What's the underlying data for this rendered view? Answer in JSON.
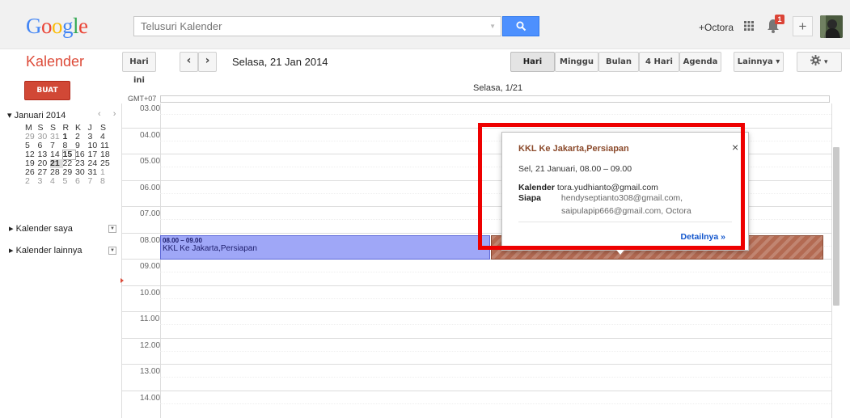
{
  "header": {
    "logo_letters": [
      "G",
      "o",
      "o",
      "g",
      "l",
      "e"
    ],
    "logo_colors": [
      "#4285f4",
      "#ea4335",
      "#fbbc05",
      "#4285f4",
      "#34a853",
      "#ea4335"
    ],
    "search_placeholder": "Telusuri Kalender",
    "user_name": "+Octora",
    "notification_count": "1",
    "share_label": "+"
  },
  "toolbar": {
    "app_title": "Kalender",
    "today_label": "Hari ini",
    "prev_label": "‹",
    "next_label": "›",
    "date_range": "Selasa, 21 Jan 2014",
    "views": {
      "day": "Hari",
      "week": "Minggu",
      "month": "Bulan",
      "four_days": "4 Hari",
      "agenda": "Agenda",
      "more": "Lainnya ▾"
    },
    "active_view": "Hari",
    "settings_caret": "▾"
  },
  "sidebar": {
    "create_label": "BUAT",
    "mini_calendar": {
      "month_label": "▾ Januari 2014",
      "nav": "‹ ›",
      "weekday_headers": [
        "M",
        "S",
        "S",
        "R",
        "K",
        "J",
        "S"
      ],
      "weeks": [
        [
          "29",
          "30",
          "31",
          "1",
          "2",
          "3",
          "4"
        ],
        [
          "5",
          "6",
          "7",
          "8",
          "9",
          "10",
          "11"
        ],
        [
          "12",
          "13",
          "14",
          "15",
          "16",
          "17",
          "18"
        ],
        [
          "19",
          "20",
          "21",
          "22",
          "23",
          "24",
          "25"
        ],
        [
          "26",
          "27",
          "28",
          "29",
          "30",
          "31",
          "1"
        ],
        [
          "2",
          "3",
          "4",
          "5",
          "6",
          "7",
          "8"
        ]
      ]
    },
    "my_calendars_label": "▸ Kalender saya",
    "other_calendars_label": "▸ Kalender lainnya"
  },
  "day_view": {
    "day_header": "Selasa, 1/21",
    "timezone": "GMT+07",
    "hours": [
      "03.00",
      "04.00",
      "05.00",
      "06.00",
      "07.00",
      "08.00",
      "09.00",
      "10.00",
      "11.00",
      "12.00",
      "13.00",
      "14.00"
    ],
    "event": {
      "time": "08.00 – 09.00",
      "title": "KKL Ke Jakarta,Persiapan",
      "color": "#9fa7f7"
    },
    "second_event_color": "#b36a52"
  },
  "popup": {
    "title": "KKL Ke Jakarta,Persiapan",
    "close": "×",
    "when": "Sel, 21 Januari, 08.00 – 09.00",
    "calendar_key": "Kalender",
    "calendar_value": "tora.yudhianto@gmail.com",
    "who_key": "Siapa",
    "who_line1": "hendyseptianto308@gmail.com,",
    "who_line2": "saipulapip666@gmail.com, Octora",
    "details_link": "Detailnya »"
  },
  "colors": {
    "accent_red": "#dd4b39",
    "search_blue": "#4d90fe",
    "highlight_box": "#ee0000"
  }
}
